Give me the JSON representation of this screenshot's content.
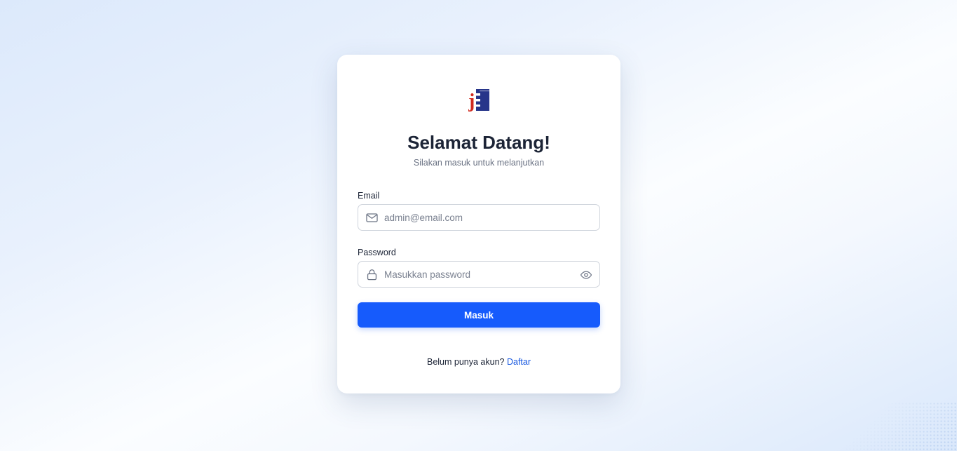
{
  "brand": {
    "logo_letter": "j",
    "logo_letter_color": "#d12a1f",
    "logo_mark_color": "#27358a"
  },
  "login": {
    "title": "Selamat Datang!",
    "subtitle": "Silakan masuk untuk melanjutkan",
    "email": {
      "label": "Email",
      "placeholder": "admin@email.com",
      "value": "",
      "icon": "mail-icon"
    },
    "password": {
      "label": "Password",
      "placeholder": "Masukkan password",
      "value": "",
      "icon": "lock-icon",
      "toggle_icon": "eye-icon"
    },
    "submit_label": "Masuk",
    "footer_text": "Belum punya akun?",
    "register_link": "Daftar"
  },
  "colors": {
    "primary": "#165bfc",
    "link": "#1556e0",
    "text": "#1c2436",
    "muted": "#6b7384"
  }
}
